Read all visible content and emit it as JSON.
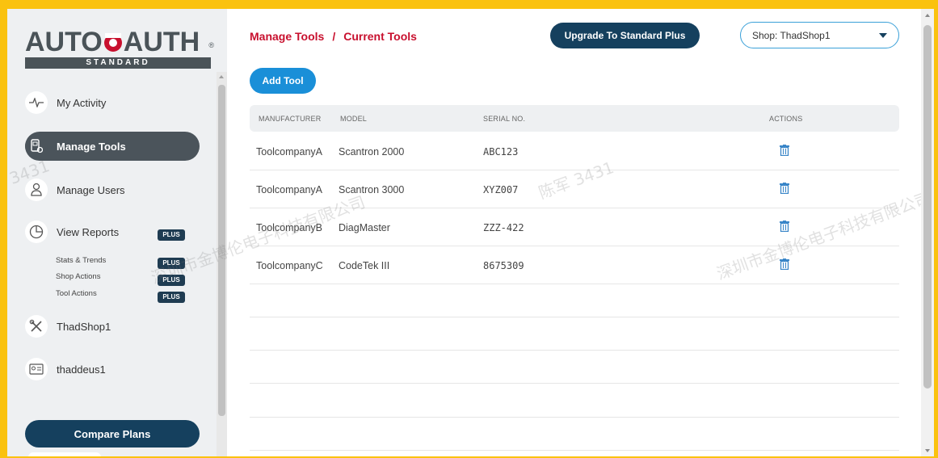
{
  "brand": {
    "logo_left": "AUTO",
    "logo_mid": "",
    "logo_right": "AUTH",
    "logo_reg": "®",
    "tier": "STANDARD"
  },
  "sidebar": {
    "items": [
      {
        "label": "My Activity",
        "icon": "activity-pulse-icon"
      },
      {
        "label": "Manage Tools",
        "icon": "tools-icon",
        "active": true
      },
      {
        "label": "Manage Users",
        "icon": "users-icon"
      },
      {
        "label": "View Reports",
        "icon": "pie-chart-icon",
        "badge": "PLUS"
      },
      {
        "label": "ThadShop1",
        "icon": "wrench-screwdriver-icon"
      },
      {
        "label": "thaddeus1",
        "icon": "id-card-icon"
      }
    ],
    "sub_items": [
      {
        "label": "Stats & Trends",
        "badge": "PLUS"
      },
      {
        "label": "Shop Actions",
        "badge": "PLUS"
      },
      {
        "label": "Tool Actions",
        "badge": "PLUS"
      }
    ],
    "compare_label": "Compare Plans"
  },
  "header": {
    "breadcrumb": [
      "Manage Tools",
      "Current Tools"
    ],
    "breadcrumb_sep": "/",
    "upgrade_label": "Upgrade To Standard Plus",
    "shop_select_value": "Shop: ThadShop1"
  },
  "toolbar": {
    "add_tool_label": "Add Tool"
  },
  "table": {
    "columns": [
      "MANUFACTURER",
      "MODEL",
      "SERIAL NO.",
      "ACTIONS"
    ],
    "rows": [
      {
        "manufacturer": "ToolcompanyA",
        "model": "Scantron 2000",
        "serial": "ABC123"
      },
      {
        "manufacturer": "ToolcompanyA",
        "model": "Scantron 3000",
        "serial": "XYZ007"
      },
      {
        "manufacturer": "ToolcompanyB",
        "model": "DiagMaster",
        "serial": "ZZZ-422"
      },
      {
        "manufacturer": "ToolcompanyC",
        "model": "CodeTek III",
        "serial": "8675309"
      }
    ]
  },
  "watermarks": [
    "深圳市金博伦电子科技有限公司",
    "陈军 3431",
    "3431"
  ],
  "colors": {
    "frame_border": "#fac20f",
    "brand_red": "#c8102e",
    "navy": "#15405e",
    "blue": "#1a8fd8",
    "active_nav": "#4b545b",
    "trash_icon": "#3a86c8"
  }
}
